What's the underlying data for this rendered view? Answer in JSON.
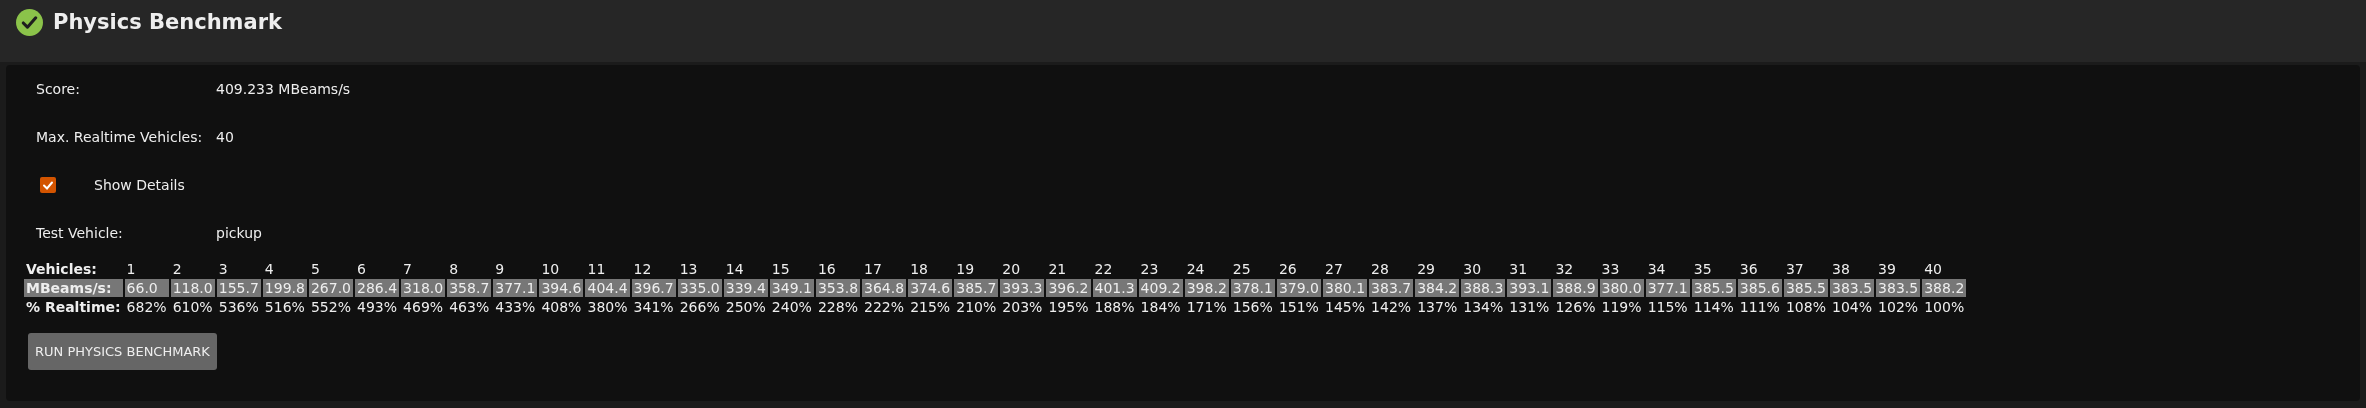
{
  "header": {
    "title": "Physics Benchmark",
    "passed": true
  },
  "fields": [
    {
      "kind": "text",
      "label": "Score:",
      "value": "409.233 MBeams/s"
    },
    {
      "kind": "text",
      "label": "Max. Realtime Vehicles:",
      "value": "40"
    },
    {
      "kind": "checkbox",
      "label": "Show Details",
      "checked": true
    },
    {
      "kind": "text",
      "label": "Test Vehicle:",
      "value": "pickup"
    }
  ],
  "table": {
    "rows": [
      {
        "kind": "plain",
        "label": "Vehicles:",
        "cells": [
          "1",
          "2",
          "3",
          "4",
          "5",
          "6",
          "7",
          "8",
          "9",
          "10",
          "11",
          "12",
          "13",
          "14",
          "15",
          "16",
          "17",
          "18",
          "19",
          "20",
          "21",
          "22",
          "23",
          "24",
          "25",
          "26",
          "27",
          "28",
          "29",
          "30",
          "31",
          "32",
          "33",
          "34",
          "35",
          "36",
          "37",
          "38",
          "39",
          "40"
        ]
      },
      {
        "kind": "highlighted",
        "label": "MBeams/s:",
        "cells": [
          "66.0",
          "118.0",
          "155.7",
          "199.8",
          "267.0",
          "286.4",
          "318.0",
          "358.7",
          "377.1",
          "394.6",
          "404.4",
          "396.7",
          "335.0",
          "339.4",
          "349.1",
          "353.8",
          "364.8",
          "374.6",
          "385.7",
          "393.3",
          "396.2",
          "401.3",
          "409.2",
          "398.2",
          "378.1",
          "379.0",
          "380.1",
          "383.7",
          "384.2",
          "388.3",
          "393.1",
          "388.9",
          "380.0",
          "377.1",
          "385.5",
          "385.6",
          "385.5",
          "383.5",
          "383.5",
          "388.2"
        ]
      },
      {
        "kind": "plain",
        "label": "% Realtime:",
        "cells": [
          "682%",
          "610%",
          "536%",
          "516%",
          "552%",
          "493%",
          "469%",
          "463%",
          "433%",
          "408%",
          "380%",
          "341%",
          "266%",
          "250%",
          "240%",
          "228%",
          "222%",
          "215%",
          "210%",
          "203%",
          "195%",
          "188%",
          "184%",
          "171%",
          "156%",
          "151%",
          "145%",
          "142%",
          "137%",
          "134%",
          "131%",
          "126%",
          "119%",
          "115%",
          "114%",
          "111%",
          "108%",
          "104%",
          "102%",
          "100%"
        ]
      }
    ]
  },
  "button": {
    "label": "RUN PHYSICS BENCHMARK"
  }
}
